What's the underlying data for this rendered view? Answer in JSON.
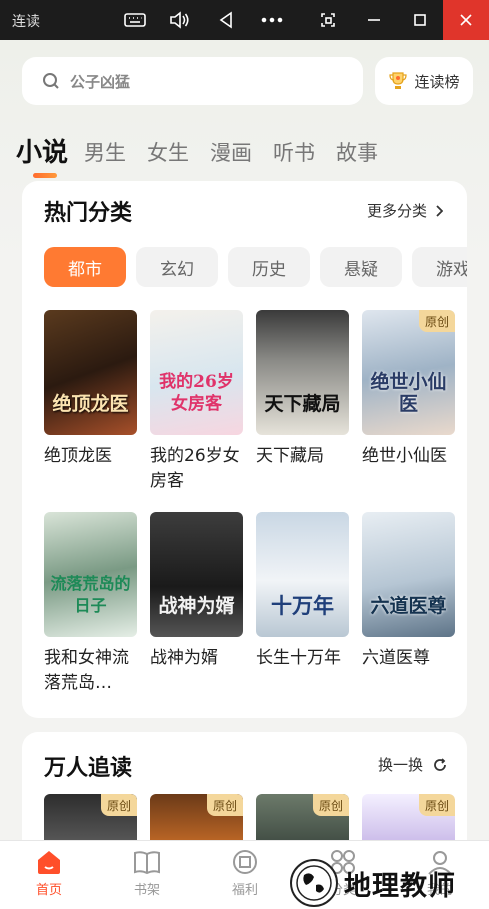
{
  "window": {
    "title": "连读",
    "controls": [
      "keyboard-icon",
      "volume-icon",
      "back-icon",
      "more-icon",
      "screenshot-icon",
      "minimize-icon",
      "maximize-icon",
      "close-icon"
    ]
  },
  "search": {
    "placeholder": "公子凶猛"
  },
  "rank_button": {
    "label": "连读榜"
  },
  "tabs": [
    "小说",
    "男生",
    "女生",
    "漫画",
    "听书",
    "故事"
  ],
  "hot_categories": {
    "title": "热门分类",
    "more_label": "更多分类",
    "chips": [
      "都市",
      "玄幻",
      "历史",
      "悬疑",
      "游戏"
    ],
    "books": [
      {
        "name": "绝顶龙医",
        "cover_text": "绝顶龙医",
        "original": false
      },
      {
        "name": "我的26岁女房客",
        "cover_text": "我的26岁女房客",
        "original": false
      },
      {
        "name": "天下藏局",
        "cover_text": "天下藏局",
        "original": false
      },
      {
        "name": "绝世小仙医",
        "cover_text": "绝世小仙医",
        "original": true
      },
      {
        "name": "我和女神流落荒岛…",
        "cover_text": "流落荒岛的日子",
        "original": false
      },
      {
        "name": "战神为婿",
        "cover_text": "战神为婿",
        "original": false
      },
      {
        "name": "长生十万年",
        "cover_text": "十万年",
        "original": false
      },
      {
        "name": "六道医尊",
        "cover_text": "六道医尊",
        "original": false
      }
    ],
    "badge_label": "原创"
  },
  "popular": {
    "title": "万人追读",
    "refresh_label": "换一换",
    "badges": [
      "原创",
      "原创",
      "原创",
      "原创"
    ]
  },
  "bottom_nav": [
    {
      "label": "首页",
      "active": true
    },
    {
      "label": "书架",
      "active": false
    },
    {
      "label": "福利",
      "active": false
    },
    {
      "label": "分类",
      "active": false
    },
    {
      "label": "我的",
      "active": false
    }
  ],
  "watermark": {
    "text": "地理教师"
  },
  "colors": {
    "accent": "#ff7a32",
    "nav_active": "#ff4f2a",
    "badge_bg": "#f4d79b",
    "close_red": "#e0352b"
  }
}
